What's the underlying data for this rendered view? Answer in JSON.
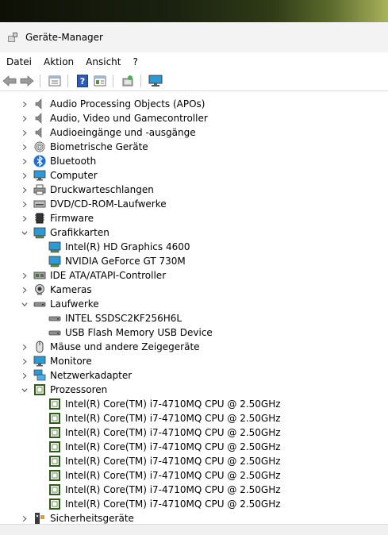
{
  "window": {
    "title": "Geräte-Manager"
  },
  "menu": [
    "Datei",
    "Aktion",
    "Ansicht",
    "?"
  ],
  "tree": [
    {
      "label": "Audio Processing Objects (APOs)",
      "level": 0,
      "expanded": false,
      "icon": "speaker-icon"
    },
    {
      "label": "Audio, Video und Gamecontroller",
      "level": 0,
      "expanded": false,
      "icon": "speaker-icon"
    },
    {
      "label": "Audioeingänge und -ausgänge",
      "level": 0,
      "expanded": false,
      "icon": "speaker-icon"
    },
    {
      "label": "Biometrische Geräte",
      "level": 0,
      "expanded": false,
      "icon": "fingerprint-icon"
    },
    {
      "label": "Bluetooth",
      "level": 0,
      "expanded": false,
      "icon": "bluetooth-icon"
    },
    {
      "label": "Computer",
      "level": 0,
      "expanded": false,
      "icon": "monitor-icon"
    },
    {
      "label": "Druckwarteschlangen",
      "level": 0,
      "expanded": false,
      "icon": "printer-icon"
    },
    {
      "label": "DVD/CD-ROM-Laufwerke",
      "level": 0,
      "expanded": false,
      "icon": "optical-drive-icon"
    },
    {
      "label": "Firmware",
      "level": 0,
      "expanded": false,
      "icon": "firmware-icon"
    },
    {
      "label": "Grafikkarten",
      "level": 0,
      "expanded": true,
      "icon": "display-adapter-icon"
    },
    {
      "label": "Intel(R) HD Graphics 4600",
      "level": 1,
      "icon": "display-adapter-icon"
    },
    {
      "label": "NVIDIA GeForce GT 730M",
      "level": 1,
      "icon": "display-adapter-icon"
    },
    {
      "label": "IDE ATA/ATAPI-Controller",
      "level": 0,
      "expanded": false,
      "icon": "ide-controller-icon"
    },
    {
      "label": "Kameras",
      "level": 0,
      "expanded": false,
      "icon": "camera-icon"
    },
    {
      "label": "Laufwerke",
      "level": 0,
      "expanded": true,
      "icon": "disk-drive-icon"
    },
    {
      "label": "INTEL SSDSC2KF256H6L",
      "level": 1,
      "icon": "disk-drive-icon"
    },
    {
      "label": "USB Flash Memory USB Device",
      "level": 1,
      "icon": "disk-drive-icon"
    },
    {
      "label": "Mäuse und andere Zeigegeräte",
      "level": 0,
      "expanded": false,
      "icon": "mouse-icon"
    },
    {
      "label": "Monitore",
      "level": 0,
      "expanded": false,
      "icon": "monitor-icon"
    },
    {
      "label": "Netzwerkadapter",
      "level": 0,
      "expanded": false,
      "icon": "network-adapter-icon"
    },
    {
      "label": "Prozessoren",
      "level": 0,
      "expanded": true,
      "icon": "cpu-icon"
    },
    {
      "label": "Intel(R) Core(TM) i7-4710MQ CPU @ 2.50GHz",
      "level": 1,
      "icon": "cpu-icon"
    },
    {
      "label": "Intel(R) Core(TM) i7-4710MQ CPU @ 2.50GHz",
      "level": 1,
      "icon": "cpu-icon"
    },
    {
      "label": "Intel(R) Core(TM) i7-4710MQ CPU @ 2.50GHz",
      "level": 1,
      "icon": "cpu-icon"
    },
    {
      "label": "Intel(R) Core(TM) i7-4710MQ CPU @ 2.50GHz",
      "level": 1,
      "icon": "cpu-icon"
    },
    {
      "label": "Intel(R) Core(TM) i7-4710MQ CPU @ 2.50GHz",
      "level": 1,
      "icon": "cpu-icon"
    },
    {
      "label": "Intel(R) Core(TM) i7-4710MQ CPU @ 2.50GHz",
      "level": 1,
      "icon": "cpu-icon"
    },
    {
      "label": "Intel(R) Core(TM) i7-4710MQ CPU @ 2.50GHz",
      "level": 1,
      "icon": "cpu-icon"
    },
    {
      "label": "Intel(R) Core(TM) i7-4710MQ CPU @ 2.50GHz",
      "level": 1,
      "icon": "cpu-icon"
    },
    {
      "label": "Sicherheitsgeräte",
      "level": 0,
      "expanded": false,
      "icon": "security-device-icon"
    }
  ],
  "colors": {
    "chevron": "#555555",
    "cpu": "#2f5a1c",
    "screen": "#2b9ad6"
  }
}
